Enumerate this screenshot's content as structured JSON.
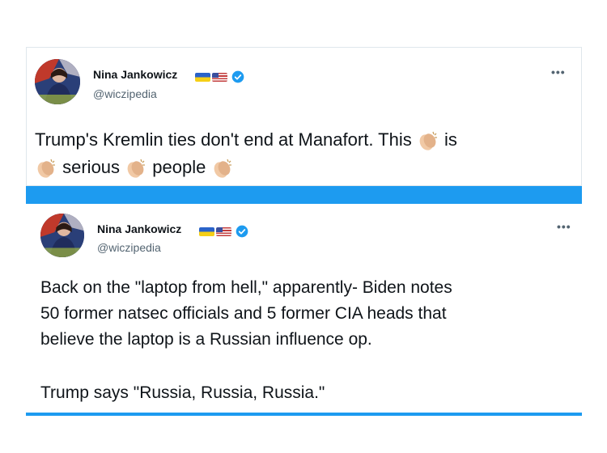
{
  "tweets": [
    {
      "author": "Nina Jankowicz",
      "handle": "@wiczipedia",
      "flags": [
        "ukraine-flag",
        "us-flag"
      ],
      "verified": true,
      "more_label": "•••",
      "text": {
        "line1": "Trump's Kremlin ties don't end at Manafort. This",
        "word_is": "is",
        "word_serious": "serious",
        "word_people": "people"
      },
      "clap_emoji": "clapping-hands-icon"
    },
    {
      "author": "Nina Jankowicz",
      "handle": "@wiczipedia",
      "flags": [
        "ukraine-flag",
        "us-flag"
      ],
      "verified": true,
      "more_label": "•••",
      "lines": [
        "Back on the \"laptop from hell,\" apparently- Biden notes",
        "50 former natsec officials and 5 former CIA heads that",
        "believe the laptop is a Russian influence op.",
        "Trump says \"Russia, Russia, Russia.\""
      ]
    }
  ],
  "colors": {
    "accent": "#1d9bf0",
    "verified": "#1d9bf0",
    "text": "#0f1419",
    "muted": "#536471"
  }
}
